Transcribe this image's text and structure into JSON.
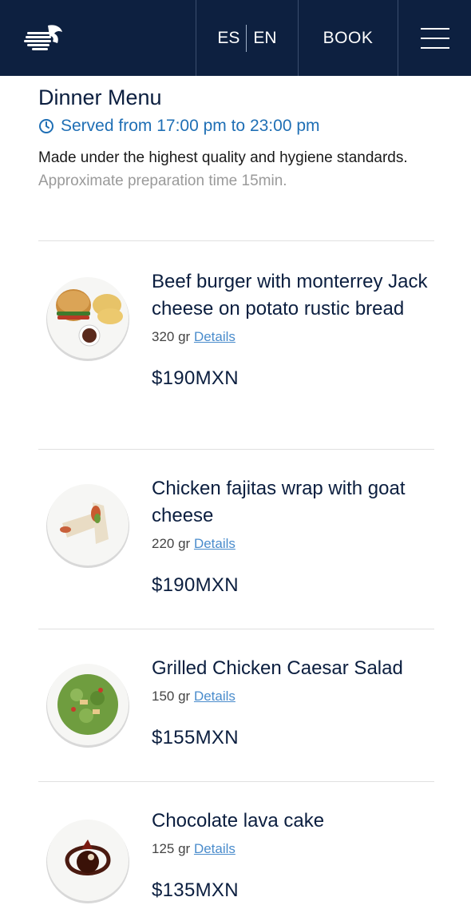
{
  "header": {
    "lang_es": "ES",
    "lang_en": "EN",
    "book_label": "BOOK"
  },
  "menu": {
    "title": "Dinner Menu",
    "served": "Served from 17:00 pm to 23:00 pm",
    "description": "Made under the highest quality and hygiene standards.",
    "prep_time": "Approximate preparation time 15min."
  },
  "items": [
    {
      "name": "Beef burger with monterrey Jack cheese on potato rustic bread",
      "weight": "320 gr",
      "details_label": "Details",
      "price": "$190MXN"
    },
    {
      "name": "Chicken fajitas wrap with goat cheese",
      "weight": "220 gr",
      "details_label": "Details",
      "price": "$190MXN"
    },
    {
      "name": "Grilled Chicken Caesar Salad",
      "weight": "150 gr",
      "details_label": "Details",
      "price": "$155MXN"
    },
    {
      "name": "Chocolate lava cake",
      "weight": "125 gr",
      "details_label": "Details",
      "price": "$135MXN"
    }
  ],
  "colors": {
    "header_bg": "#0d2040",
    "accent": "#1f6fb5",
    "link": "#4a8ccc"
  }
}
